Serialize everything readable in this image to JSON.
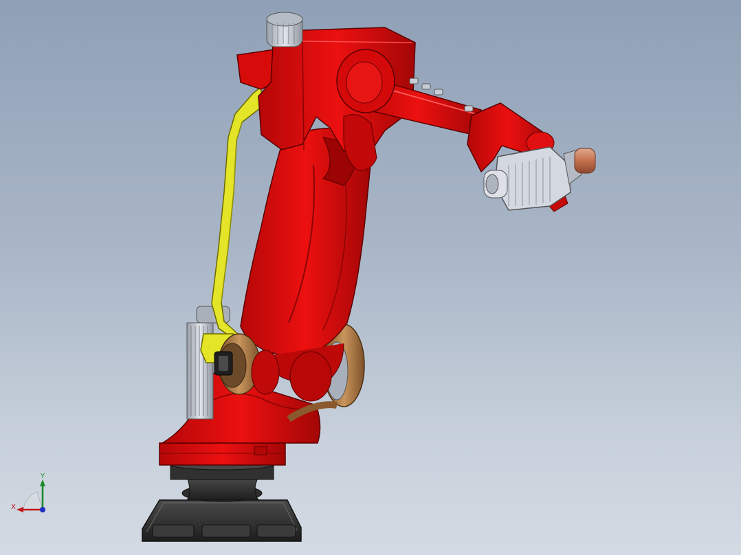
{
  "viewport": {
    "background_top": "#8fa0b6",
    "background_bottom": "#d3dae3"
  },
  "model": {
    "name": "robot-arm",
    "colors": {
      "body_red": "#e00b0b",
      "body_red_dark": "#a30606",
      "linkage_yellow": "#d8d81c",
      "bronze": "#b07a42",
      "motor_gray": "#c9cdd6",
      "base_black": "#2b2b2b",
      "end_effector_copper": "#c77a5a"
    }
  },
  "triad": {
    "x_label": "X",
    "y_label": "Y",
    "x_color": "#c21818",
    "y_color": "#1d8a2a",
    "z_color": "#1c2ec2"
  }
}
